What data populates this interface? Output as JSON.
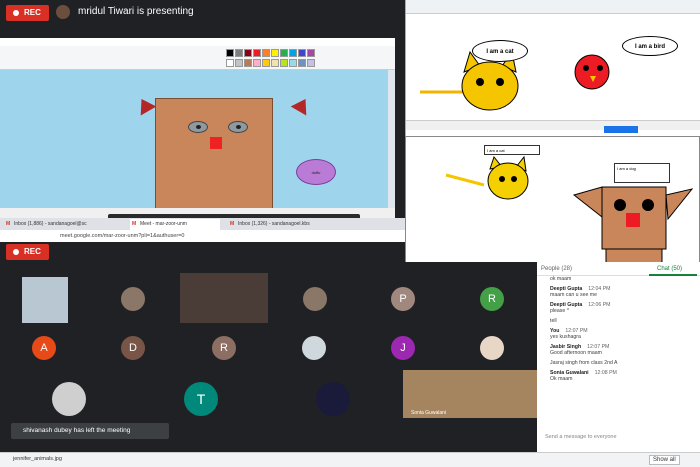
{
  "meet": {
    "rec_label": "REC",
    "presenting_text": "mridul Tiwari is presenting",
    "toast": "shivanash dubey has left the meeting",
    "self_name": "Sonia Guwalani"
  },
  "paint": {
    "cloud_text": "duffu"
  },
  "browser": {
    "tabs": [
      "Inbox (1,886) - sandanagoel@sc",
      "Meet - mar-zoor-unm",
      "Inbox (1,326) - sandanagoel.kbs"
    ],
    "url": "meet.google.com/mar-zoor-unm?pli=1&authuser=0"
  },
  "right_top": {
    "cat_bubble": "I am a cat",
    "bird_bubble": "I am a bird"
  },
  "right_bottom": {
    "cat_bubble": "I am a cat",
    "dog_bubble": "I am a dog"
  },
  "participants": {
    "letters": [
      {
        "letter": "P",
        "color": "#a1887f"
      },
      {
        "letter": "R",
        "color": "#43a047"
      },
      {
        "letter": "A",
        "color": "#e64a19"
      },
      {
        "letter": "D",
        "color": "#795548"
      },
      {
        "letter": "R",
        "color": "#8d6e63"
      },
      {
        "letter": "J",
        "color": "#9c27b0"
      },
      {
        "letter": "T",
        "color": "#00897b"
      }
    ]
  },
  "chat": {
    "people_label": "People (28)",
    "chat_label": "Chat (50)",
    "messages": [
      {
        "text": "ok maam"
      },
      {
        "name": "Deepti Gupta",
        "time": "12:04 PM",
        "text": "maam can u see me"
      },
      {
        "name": "Deepti Gupta",
        "time": "12:06 PM",
        "text": "please ^"
      },
      {
        "text": "tell"
      },
      {
        "name": "You",
        "time": "12:07 PM",
        "text": "yes kushagra"
      },
      {
        "name": "Jasbir Singh",
        "time": "12:07 PM",
        "text": "Good afternoon maam"
      },
      {
        "text": "Jasraj singh from class 2nd A"
      },
      {
        "name": "Sonia Guwalani",
        "time": "12:08 PM",
        "text": "Ok maam"
      }
    ],
    "input_placeholder": "Send a message to everyone"
  },
  "downloads": {
    "file": "jennifer_animals.jpg",
    "show_all": "Show all"
  }
}
